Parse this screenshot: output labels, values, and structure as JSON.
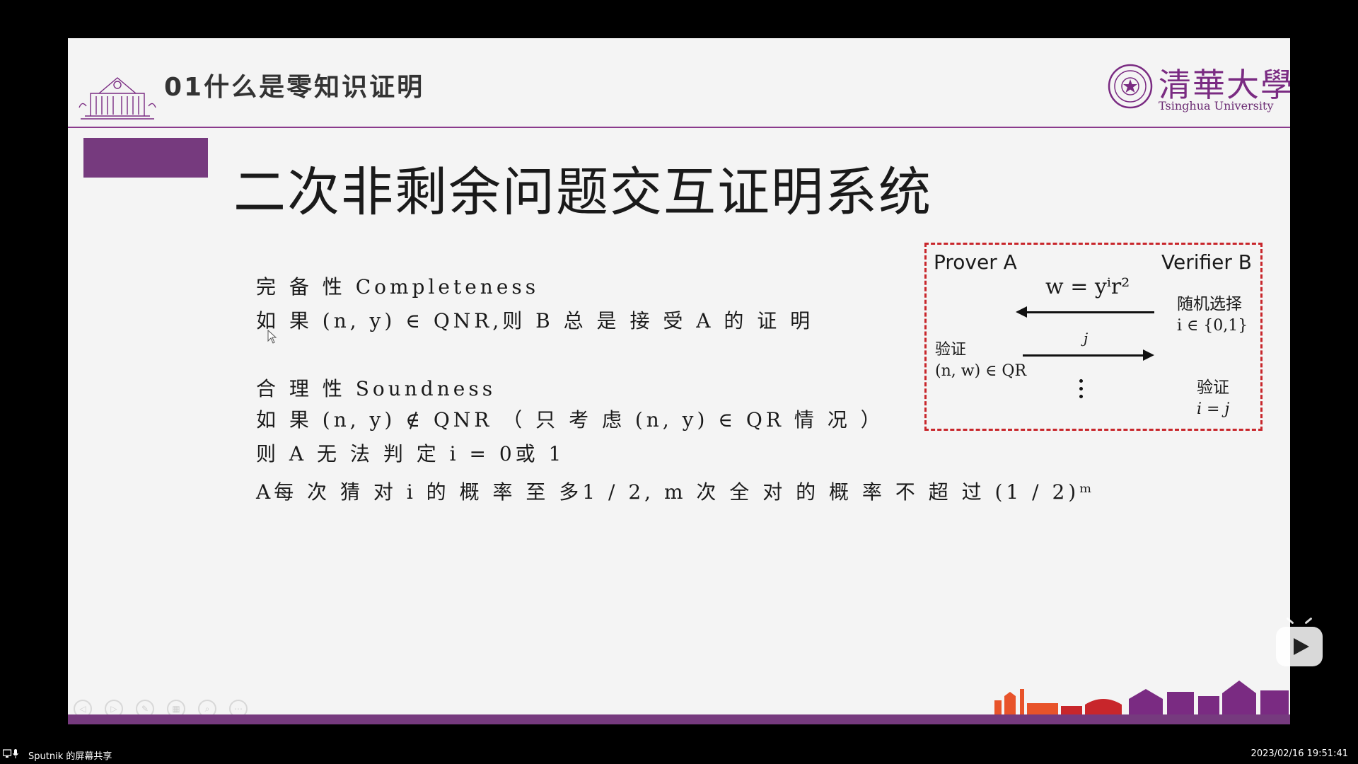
{
  "header": {
    "section_title": "01什么是零知识证明",
    "university_cn": "清華大學",
    "university_en": "Tsinghua University"
  },
  "slide": {
    "title": "二次非剩余问题交互证明系统",
    "lines": [
      "完 备 性  Completeness",
      "如 果 (n, y) ∈ QNR,则 B 总 是 接 受 A 的 证 明",
      "合 理 性  Soundness",
      "如 果 (n, y) ∉ QNR  （ 只 考 虑 (n, y) ∈ QR  情 况 ）",
      "则 A  无 法 判 定 i = 0或 1",
      "A每 次 猜 对 i  的 概 率 至 多1 / 2, m  次 全 对 的 概 率 不 超 过 (1 / 2)ᵐ"
    ]
  },
  "diagram": {
    "prover": "Prover A",
    "verifier": "Verifier B",
    "message_w": "w = yⁱr²",
    "random_choice": "随机选择",
    "i_set": "i ∈ {0,1}",
    "verify_left": "验证",
    "verify_left_cond": "(n, w) ∈ QR",
    "message_j": "j",
    "verify_right": "验证",
    "verify_right_cond": "i = j"
  },
  "status_bar": {
    "share_label": "Sputnik 的屏幕共享",
    "timestamp": "2023/02/16 19:51:41"
  },
  "colors": {
    "accent_purple": "#763a7e",
    "diagram_border": "#c8262b"
  }
}
